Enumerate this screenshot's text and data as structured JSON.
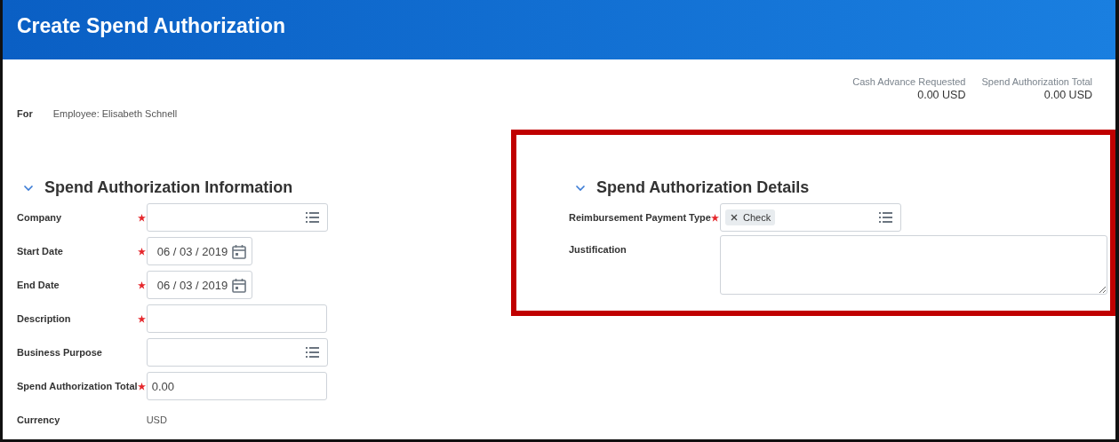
{
  "header": {
    "title": "Create Spend Authorization"
  },
  "totals": [
    {
      "label": "Cash Advance Requested",
      "value": "0.00 USD"
    },
    {
      "label": "Spend Authorization Total",
      "value": "0.00 USD"
    }
  ],
  "for_field": {
    "label": "For",
    "value": "Employee: Elisabeth Schnell"
  },
  "sections": [
    {
      "title": "Spend Authorization Information",
      "expanded": true,
      "highlighted": false,
      "fields": [
        {
          "kind": "prompt",
          "label": "Company",
          "required": true
        },
        {
          "kind": "date",
          "label": "Start Date",
          "required": true,
          "value": "06 / 03 / 2019"
        },
        {
          "kind": "date",
          "label": "End Date",
          "required": true,
          "value": "06 / 03 / 2019"
        },
        {
          "kind": "text",
          "label": "Description",
          "required": true
        },
        {
          "kind": "prompt",
          "label": "Business Purpose",
          "required": false
        },
        {
          "kind": "text",
          "label": "Spend Authorization Total",
          "required": true,
          "value": "0.00"
        },
        {
          "kind": "static",
          "label": "Currency",
          "required": false,
          "value": "USD"
        }
      ]
    },
    {
      "title": "Spend Authorization Details",
      "expanded": true,
      "highlighted": true,
      "fields": [
        {
          "kind": "prompt",
          "label": "Reimbursement Payment Type",
          "required": true,
          "chips": [
            "Check"
          ]
        },
        {
          "kind": "textarea",
          "label": "Justification",
          "required": false
        }
      ]
    }
  ]
}
